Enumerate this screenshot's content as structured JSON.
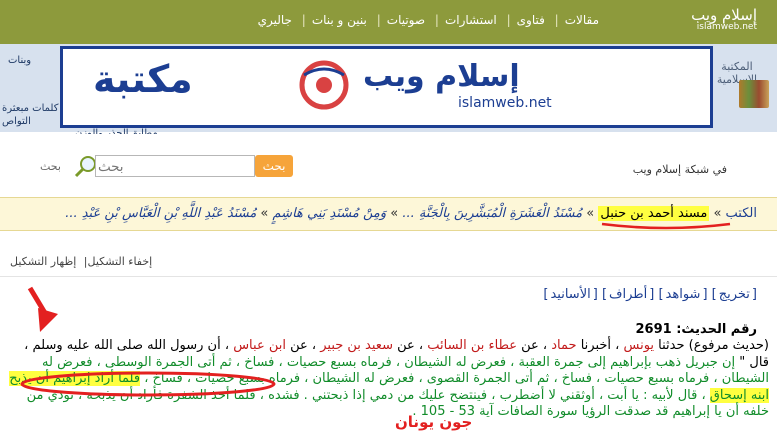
{
  "topnav": {
    "items": [
      "مقالات",
      "فتاوى",
      "استشارات",
      "صوتيات",
      "بنين و بنات",
      "جاليري"
    ],
    "logo_text": "إسلام ويب",
    "logo_sub": "islamweb.net"
  },
  "overlay": {
    "maktaba": "مكتبة",
    "arabic": "إسلام ويب",
    "latin": "islamweb.net"
  },
  "library_label": "المكتبة الإسلامية",
  "left_panel": {
    "t1": "وبنات",
    "t2": "كلمات مبعثرة",
    "t3": "التواص",
    "t4": "الجذر والوزن",
    "t5": "مطابق"
  },
  "search": {
    "button_label": "بحث",
    "placeholder": "بحث",
    "scope": "في شبكة إسلام ويب"
  },
  "breadcrumb": {
    "root": "الكتب",
    "c1": "مسند أحمد بن حنبل",
    "c2": "مُسْنَدُ الْعَشَرَةِ الْمُبَشَّرِينَ بِالْجَنَّةِ ...",
    "c3": "وَمِنْ مُسْنَدِ بَنِي هَاشِمٍ",
    "c4": "مُسْنَدُ عَبْدِ اللَّهِ بْنِ الْعَبَّاسِ بْنِ عَبْدِ ..."
  },
  "tashkeel": {
    "show": "إظهار التشكيل",
    "hide": "إخفاء التشكيل"
  },
  "refs": {
    "takhrij": "تخريج",
    "shawahid": "شواهد",
    "atraf": "أطراف",
    "asanid": "الأسانيد"
  },
  "hadith": {
    "number_label": "رقم الحديث:",
    "number": "2691",
    "p1": "(حديث مرفوع) حدثنا ",
    "narrator1": "يونس",
    "p2": " ، أخبرنا ",
    "narrator2": "حماد",
    "p3": " ، عن ",
    "narrator3": "عطاء بن السائب",
    "p4": " ، عن ",
    "narrator4": "سعيد بن جبير",
    "p5": " ، عن ",
    "narrator5": "ابن عباس",
    "p6": " ، أن رسول الله صلى الله عليه وسلم ، قال \" ",
    "text1": "إن جبريل ذهب بإبراهيم إلى جمرة العقبة ، فعرض له الشيطان ، فرماه بسبع حصيات ، فساخ ، ثم أتى الجمرة الوسطى ، فعرض له الشيطان ، فرماه بسبع حصيات ، فساخ ، ثم أتى الجمرة القصوى ، فعرض له الشيطان ، فرماه بسبع حصيات ، فساخ ، ",
    "highlight": "فلما أراد إبراهيم أن يذبح ابنه إسحاق",
    "text2": " ، قال لأبيه : يا أبت ، أوثقني لا أضطرب ، فينتضح عليك من دمي إذا ذبحتني . فشده ، فلما أخذ الشفرة فأراد أن يذبحه ، نودي من خلفه أن يا إبراهيم قد صدقت الرؤيا سورة الصافات آية 53 - 105 ."
  },
  "annotation": {
    "signature": "جون يونان"
  }
}
